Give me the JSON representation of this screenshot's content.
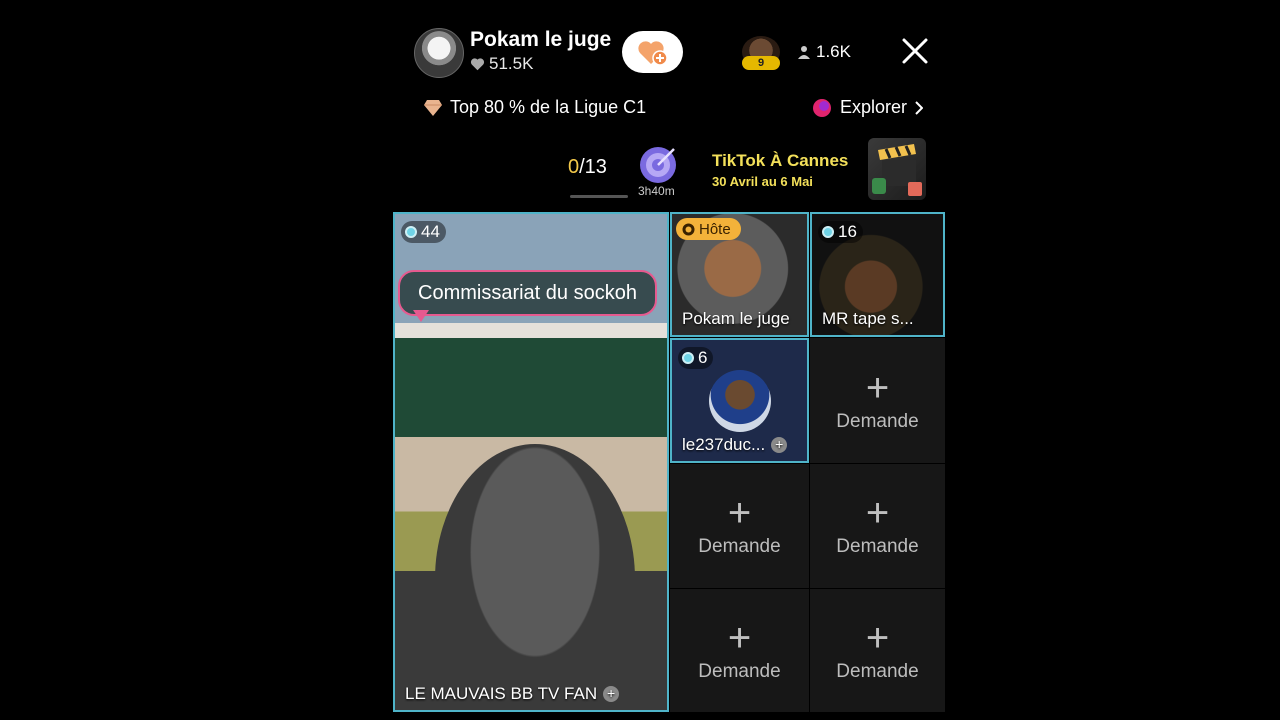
{
  "header": {
    "host_name": "Pokam le juge",
    "likes": "51.5K",
    "viewer_badge": "9",
    "viewer_count": "1.6K"
  },
  "subheader": {
    "league": "Top 80 % de la Ligue C1",
    "explore": "Explorer"
  },
  "goal": {
    "current": "0",
    "total": "/13",
    "timer": "3h40m"
  },
  "promo": {
    "title": "TikTok À Cannes",
    "subtitle": "30 Avril au 6 Mai"
  },
  "tiles": {
    "main": {
      "score": "44",
      "bubble": "Commissariat du sockoh",
      "name": "LE MAUVAIS BB TV FAN"
    },
    "host": {
      "badge": "Hôte",
      "name": "Pokam le juge"
    },
    "guest2": {
      "score": "16",
      "name": "MR tape s..."
    },
    "guest3": {
      "score": "6",
      "name": "le237duc..."
    }
  },
  "empty_slot_label": "Demande",
  "colors": {
    "accent": "#4fb4c9",
    "goal": "#f3c94a",
    "promo": "#f3e05a",
    "host_badge": "#f3b23a"
  }
}
